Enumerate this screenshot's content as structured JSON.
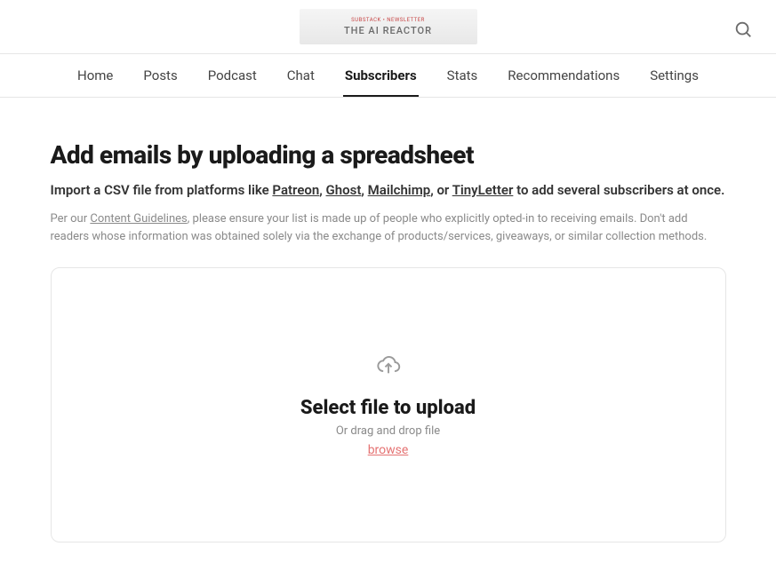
{
  "header": {
    "logo_small": "SUBSTACK  •  NEWSLETTER",
    "logo_text": "THE AI REACTOR"
  },
  "nav": {
    "items": [
      "Home",
      "Posts",
      "Podcast",
      "Chat",
      "Subscribers",
      "Stats",
      "Recommendations",
      "Settings"
    ],
    "active_index": 4
  },
  "page": {
    "title": "Add emails by uploading a spreadsheet",
    "intro_prefix": "Import a CSV file from platforms like ",
    "intro_links": [
      "Patreon",
      "Ghost",
      "Mailchimp",
      "TinyLetter"
    ],
    "intro_sep_comma": ", ",
    "intro_sep_or": ", or ",
    "intro_suffix": " to add several subscribers at once.",
    "note_prefix": "Per our ",
    "note_link": "Content Guidelines",
    "note_suffix": ", please ensure your list is made up of people who explicitly opted-in to receiving emails. Don't add readers whose information was obtained solely via the exchange of products/services, giveaways, or similar collection methods."
  },
  "dropzone": {
    "title": "Select file to upload",
    "subtitle": "Or drag and drop file",
    "browse": "browse"
  }
}
